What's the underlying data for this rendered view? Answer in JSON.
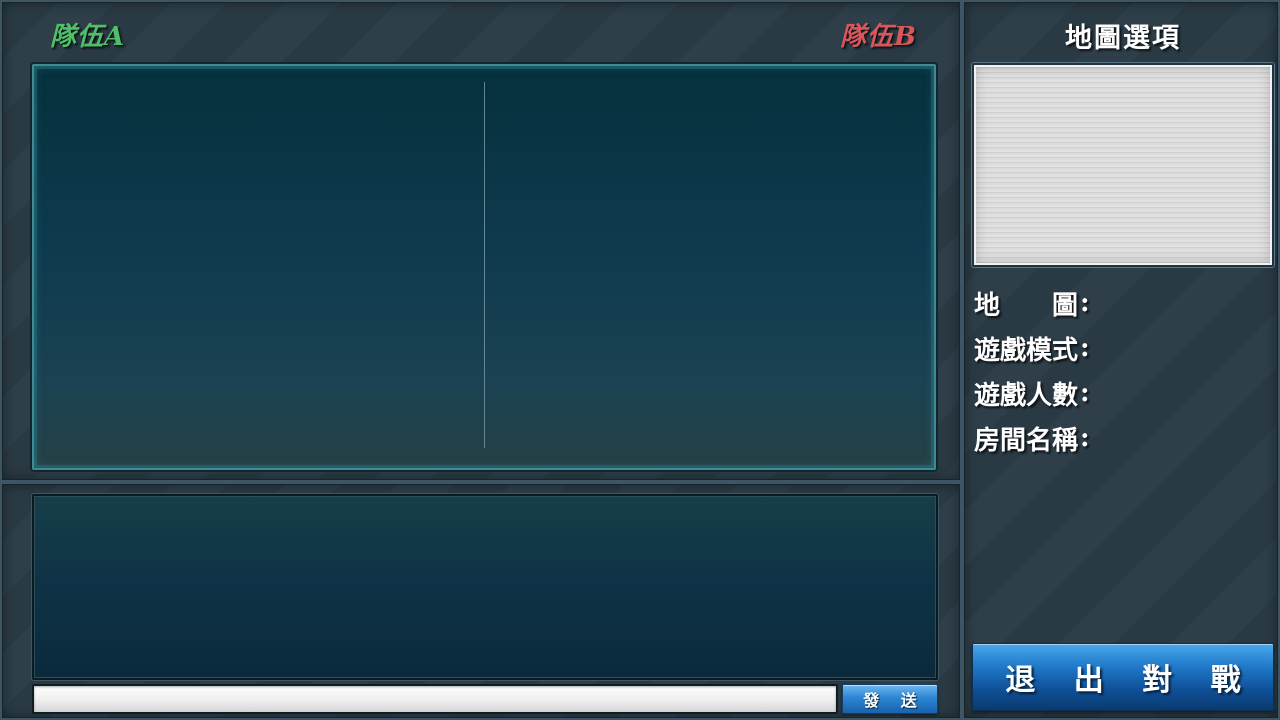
{
  "teams": {
    "team_a": {
      "title": "隊伍A",
      "color": "#4fc06a",
      "players": []
    },
    "team_b": {
      "title": "隊伍B",
      "color": "#d9575a",
      "players": []
    }
  },
  "chat": {
    "messages": [],
    "input_value": "",
    "send_label": "發 送"
  },
  "map_options": {
    "title": "地圖選項",
    "fields": {
      "map": {
        "label": "地　　圖",
        "colon": ":",
        "value": ""
      },
      "game_mode": {
        "label": "遊戲模式",
        "colon": ":",
        "value": ""
      },
      "player_count": {
        "label": "遊戲人數",
        "colon": ":",
        "value": ""
      },
      "room_name": {
        "label": "房間名稱",
        "colon": ":",
        "value": ""
      }
    },
    "exit_label": "退 出 對 戰"
  },
  "colors": {
    "accent_blue": "#1f78c8",
    "frame_teal": "#3c8c96"
  }
}
